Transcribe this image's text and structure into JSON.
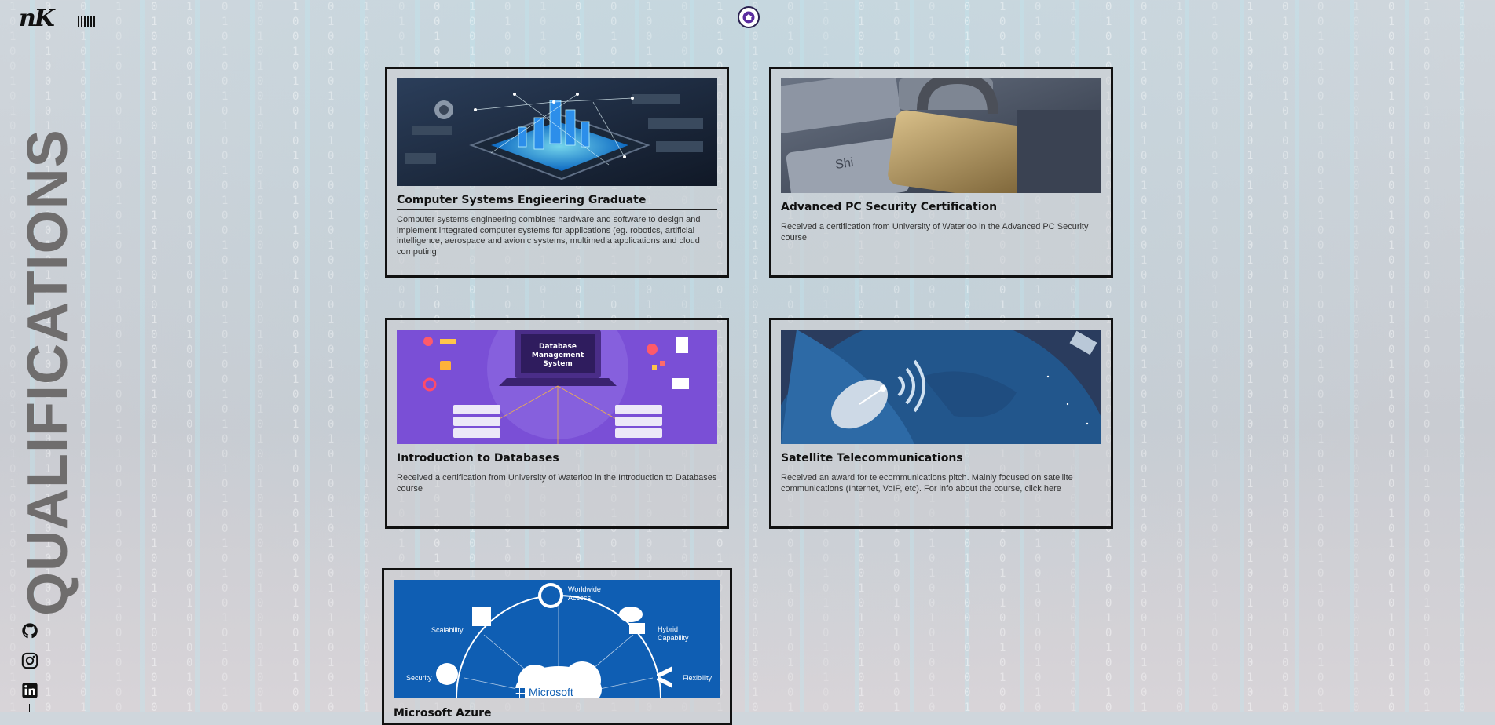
{
  "brand": {
    "logo": "nK"
  },
  "side": {
    "title": "QUALIFICATIONS"
  },
  "icons": {
    "home": "home-icon",
    "menu": "menu-icon",
    "github": "github-icon",
    "instagram": "instagram-icon",
    "linkedin": "linkedin-icon"
  },
  "colors": {
    "card_border": "#111111",
    "home_accent": "#5b2ca0",
    "side_title": "#6f6d6d"
  },
  "cards": [
    {
      "title": "Computer Systems Engieering Graduate",
      "description": "Computer systems engineering combines hardware and software to design and implement integrated computer systems for applications (eg. robotics, artificial intelligence, aerospace and avionic systems, multimedia applications and cloud computing",
      "image": "circuit-city-image"
    },
    {
      "title": "Advanced PC Security Certification",
      "description": "Received a certification from University of Waterloo in the Advanced PC Security course",
      "image": "padlock-keyboard-image"
    },
    {
      "title": "Introduction to Databases",
      "description": "Received a certification from University of Waterloo in the Introduction to Databases course",
      "image": "database-management-system-image",
      "image_text": [
        "Database",
        "Management",
        "System"
      ]
    },
    {
      "title": "Satellite Telecommunications",
      "description": "Received an award for telecommunications pitch. Mainly focused on satellite communications (Internet, VoIP, etc). For info about the course, click here",
      "image": "satellite-dish-image"
    },
    {
      "title": "Microsoft Azure",
      "description": "",
      "image": "microsoft-azure-image",
      "image_text": {
        "worldwide": "Worldwide",
        "access": "Access",
        "scalability": "Scalability",
        "hybrid": "Hybrid",
        "capability": "Capability",
        "security": "Security",
        "flexibility": "Flexibility",
        "brand": "Microsoft"
      }
    }
  ]
}
